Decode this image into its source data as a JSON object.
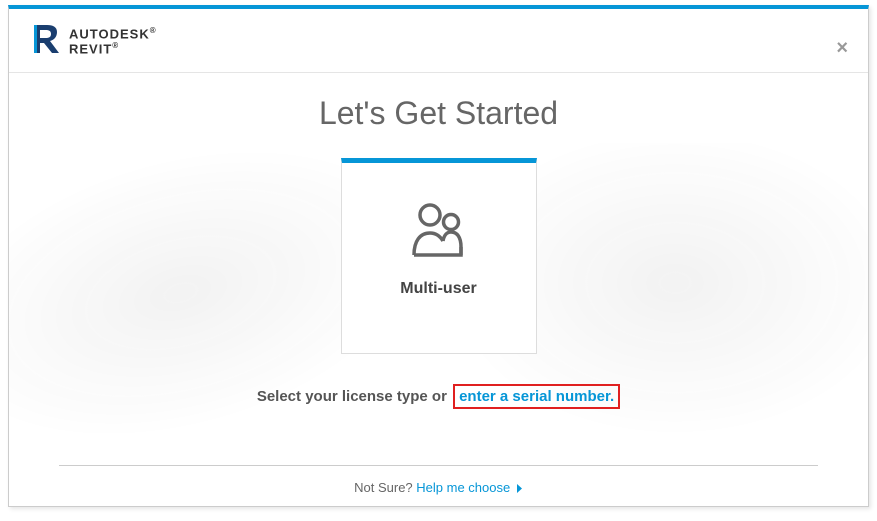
{
  "brand": {
    "company": "AUTODESK",
    "product": "REVIT",
    "registered": "®"
  },
  "title": "Let's Get Started",
  "card": {
    "label": "Multi-user"
  },
  "subtitle": {
    "prefix": "Select your license type or ",
    "link": "enter a serial number."
  },
  "footer": {
    "prefix": "Not Sure? ",
    "link": "Help me choose"
  }
}
